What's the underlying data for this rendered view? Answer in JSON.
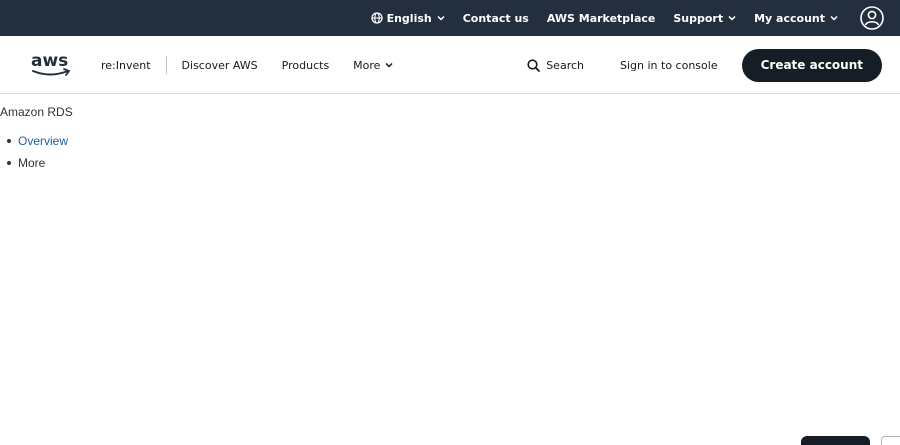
{
  "topbar": {
    "language": "English",
    "contact": "Contact us",
    "marketplace": "AWS Marketplace",
    "support": "Support",
    "account": "My account"
  },
  "nav": {
    "logo_text": "aws",
    "items": [
      "re:Invent",
      "Discover AWS",
      "Products",
      "More"
    ],
    "search": "Search",
    "signin": "Sign in to console",
    "create_account": "Create account"
  },
  "content": {
    "breadcrumb": "Amazon RDS",
    "list": [
      "Overview",
      "More"
    ]
  },
  "colors": {
    "topbar_bg": "#232f3e",
    "button_bg": "#161d26",
    "link": "#1f5fa8",
    "logo_smile": "#ff9900"
  }
}
